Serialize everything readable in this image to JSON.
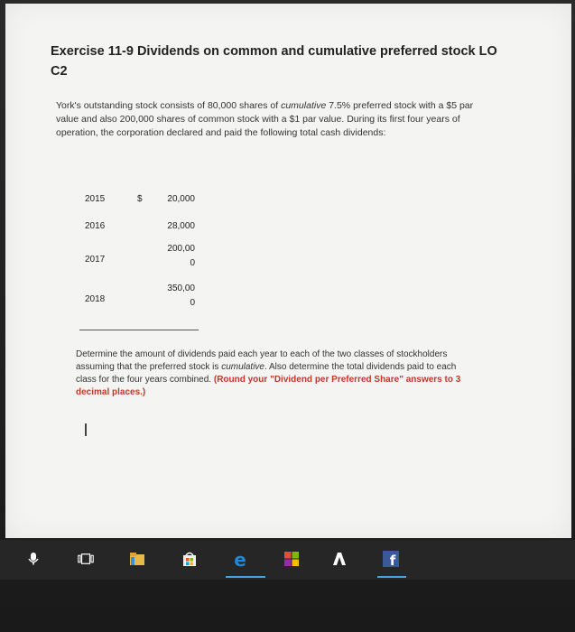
{
  "exercise": {
    "title_line1": "Exercise 11-9 Dividends on common and cumulative preferred stock LO",
    "title_line2": "C2"
  },
  "intro": {
    "line1_a": "York's outstanding stock consists of 80,000 shares of ",
    "line1_italic": "cumulative",
    "line1_b": " 7.5% preferred stock with a $5 par",
    "line2": "value and also 200,000 shares of common stock with a $1 par value. During its first four years of",
    "line3": "operation, the corporation declared and paid the following total cash dividends:"
  },
  "dividends": {
    "currency_symbol": "$",
    "rows": [
      {
        "year": "2015",
        "amount_line1": "20,000",
        "amount_line2": ""
      },
      {
        "year": "2016",
        "amount_line1": "28,000",
        "amount_line2": ""
      },
      {
        "year": "2017",
        "amount_line1": "200,00",
        "amount_line2": "0"
      },
      {
        "year": "2018",
        "amount_line1": "350,00",
        "amount_line2": "0"
      }
    ]
  },
  "task": {
    "line1": "Determine the amount of dividends paid each year to each of the two classes of stockholders",
    "line2_a": "assuming that the preferred stock is ",
    "line2_italic": "cumulative",
    "line2_b": ". Also determine the total dividends paid to each",
    "line3_a": "class for the four years combined. ",
    "line3_red": "(Round your \"Dividend per Preferred Share\" answers to 3",
    "line4_red": "decimal places.)"
  },
  "taskbar": {
    "icons": [
      "microphone-icon",
      "task-view-icon",
      "file-explorer-icon",
      "store-icon",
      "edge-icon",
      "app-icon",
      "app2-icon",
      "facebook-icon"
    ],
    "colors": {
      "edge": "#1e88d6",
      "facebook": "#3b5998",
      "store": "#ffb900"
    }
  }
}
